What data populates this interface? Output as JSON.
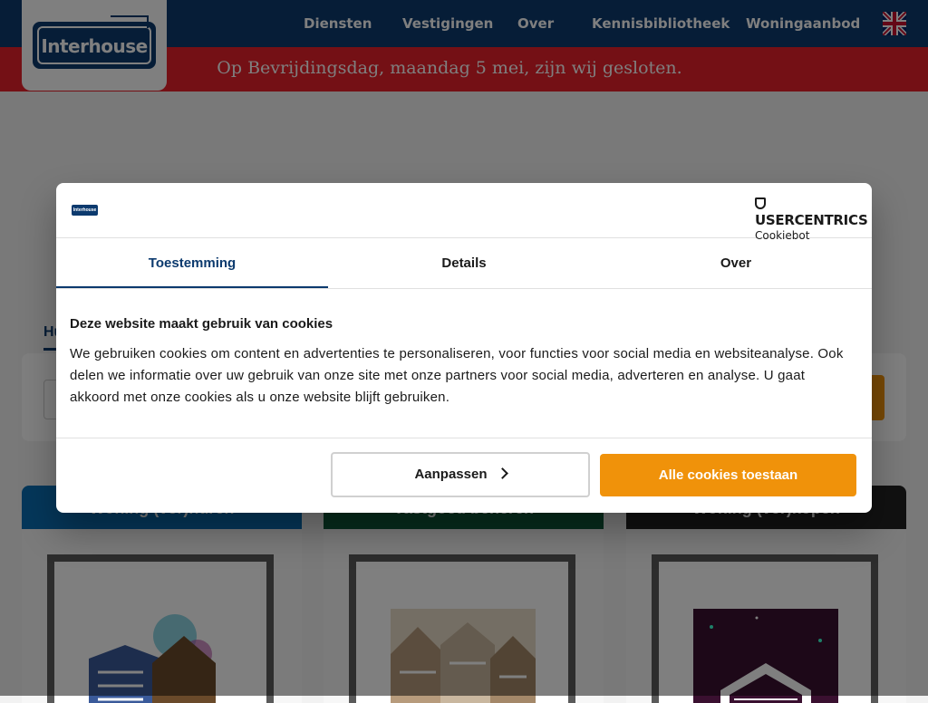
{
  "header": {
    "logo_text": "Interhouse",
    "nav": [
      "Diensten",
      "Vestigingen",
      "Over",
      "Kennisbibliotheek",
      "Woningaanbod"
    ],
    "language_icon": "uk-flag-icon",
    "colors": {
      "navy": "#0c3a6e",
      "alert_red": "#e8202a",
      "accent_orange": "#f0920a"
    }
  },
  "alert": {
    "text": "Op Bevrijdingsdag, maandag 5 mei, zijn wij gesloten."
  },
  "background": {
    "search_tab_label": "Hu",
    "cards": [
      {
        "title": "Woning (ver)huren",
        "color": "#0b6fb5"
      },
      {
        "title": "Vastgoed beheren",
        "color": "#0f5a3a"
      },
      {
        "title": "Woning (ver)kopen",
        "color": "#222222"
      }
    ]
  },
  "cookie_dialog": {
    "brand_top": "USERCENTRICS",
    "brand_bottom": "Cookiebot",
    "logo_mini": "Interhouse",
    "tabs": [
      "Toestemming",
      "Details",
      "Over"
    ],
    "active_tab": "Toestemming",
    "title": "Deze website maakt gebruik van cookies",
    "text": "We gebruiken cookies om content en advertenties te personaliseren, voor functies voor social media en websiteanalyse. Ook delen we informatie over uw gebruik van onze site met onze partners voor social media, adverteren en analyse. U gaat akkoord met onze cookies als u onze website blijft gebruiken.",
    "btn_customize": "Aanpassen",
    "btn_allow_all": "Alle cookies toestaan"
  }
}
